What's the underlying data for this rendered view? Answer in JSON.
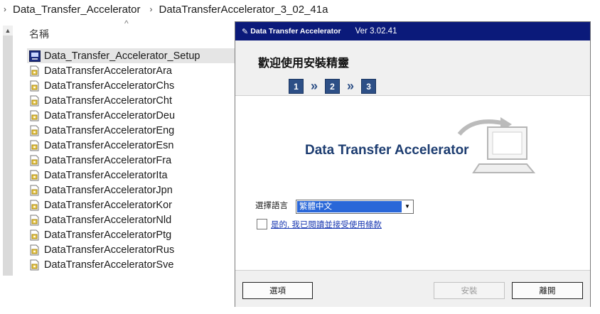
{
  "breadcrumb": {
    "items": [
      "Data_Transfer_Accelerator",
      "DataTransferAccelerator_3_02_41a"
    ]
  },
  "explorer": {
    "column_name": "名稱",
    "files": [
      "Data_Transfer_Accelerator_Setup",
      "DataTransferAcceleratorAra",
      "DataTransferAcceleratorChs",
      "DataTransferAcceleratorCht",
      "DataTransferAcceleratorDeu",
      "DataTransferAcceleratorEng",
      "DataTransferAcceleratorEsn",
      "DataTransferAcceleratorFra",
      "DataTransferAcceleratorIta",
      "DataTransferAcceleratorJpn",
      "DataTransferAcceleratorKor",
      "DataTransferAcceleratorNld",
      "DataTransferAcceleratorPtg",
      "DataTransferAcceleratorRus",
      "DataTransferAcceleratorSve"
    ],
    "selected_index": 0
  },
  "installer": {
    "brand": "Data Transfer Accelerator",
    "version": "Ver 3.02.41",
    "welcome": "歡迎使用安裝精靈",
    "steps": [
      "1",
      "2",
      "3"
    ],
    "step_separator": "»",
    "product_name": "Data Transfer Accelerator",
    "language_label": "選擇語言",
    "language_value": "繁體中文",
    "agree_text": "是的, 我已閱讀並接受使用條款",
    "options_button": "選項",
    "install_button": "安裝",
    "exit_button": "離開"
  },
  "colors": {
    "titlebar": "#0b1a7a",
    "step_box": "#2d4f86",
    "product_text": "#1c3c70",
    "selection": "#2a67d8"
  }
}
